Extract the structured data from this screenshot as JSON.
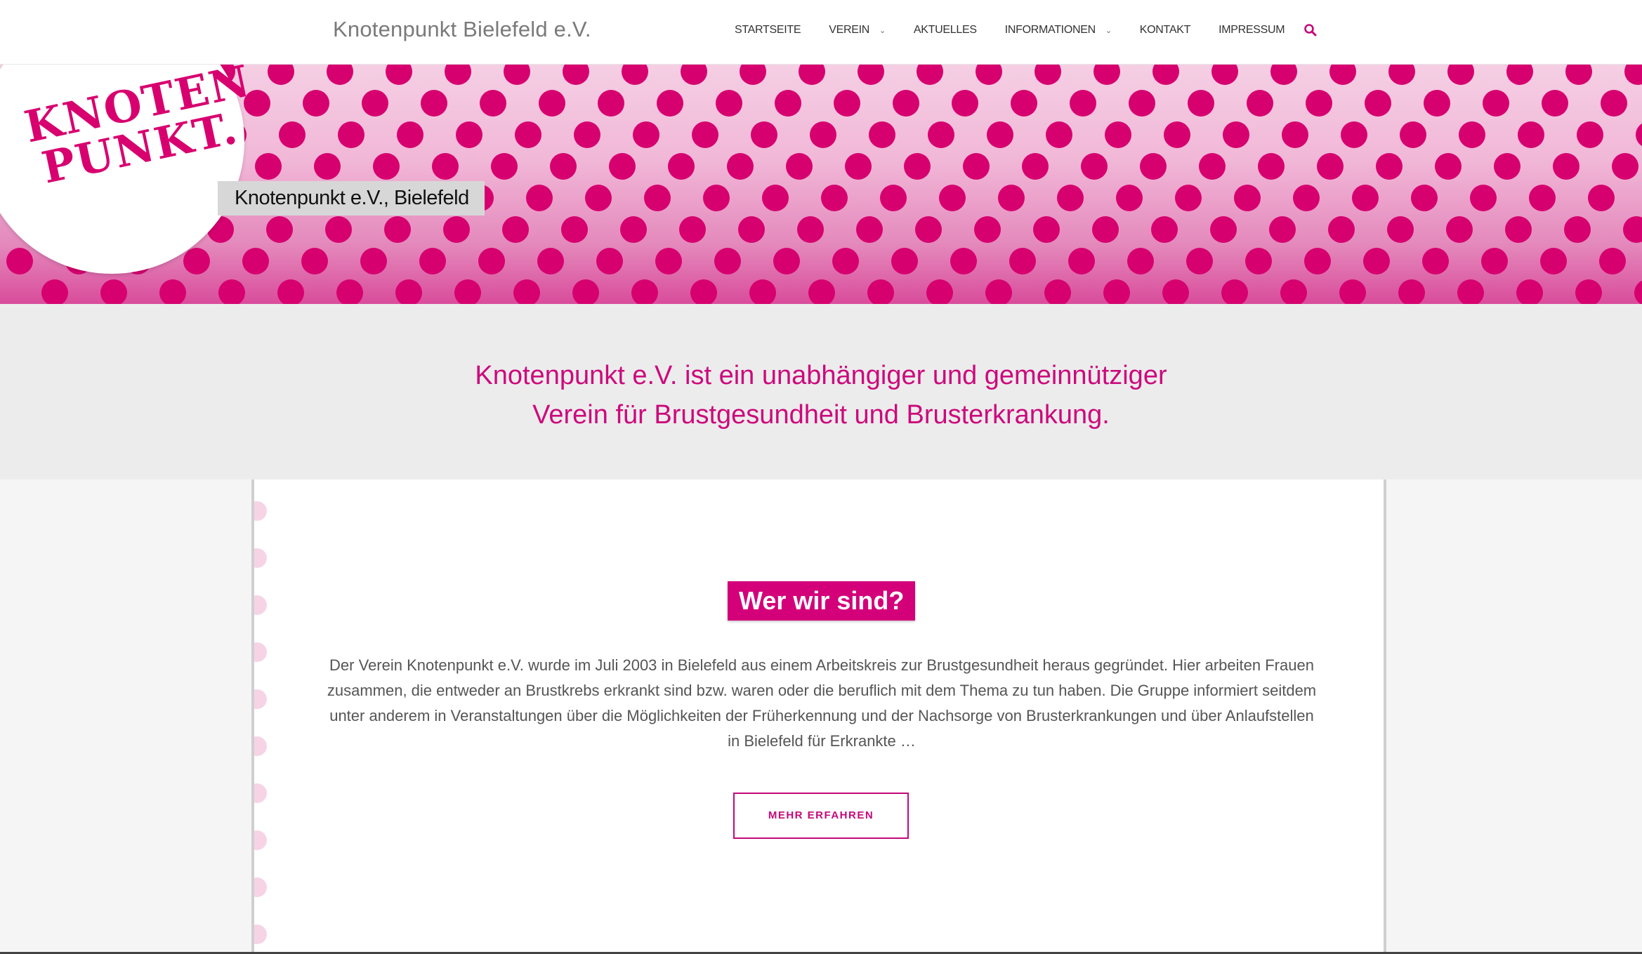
{
  "header": {
    "site_title": "Knotenpunkt Bielefeld e.V.",
    "nav": [
      {
        "label": "STARTSEITE",
        "has_dropdown": false
      },
      {
        "label": "VEREIN",
        "has_dropdown": true
      },
      {
        "label": "AKTUELLES",
        "has_dropdown": false
      },
      {
        "label": "INFORMATIONEN",
        "has_dropdown": true
      },
      {
        "label": "KONTAKT",
        "has_dropdown": false
      },
      {
        "label": "IMPRESSUM",
        "has_dropdown": false
      }
    ],
    "search_icon": "search-icon"
  },
  "banner": {
    "logo_line1": "KNOTEN",
    "logo_line2": "PUNKT.",
    "label": "Knotenpunkt e.V., Bielefeld"
  },
  "tagline": {
    "line1": "Knotenpunkt e.V. ist ein unabhängiger und gemeinnütziger",
    "line2": "Verein für Brustgesundheit und Brusterkrankung."
  },
  "about": {
    "heading": "Wer wir sind?",
    "text": "Der Verein Knotenpunkt e.V. wurde im Juli 2003 in Bielefeld aus einem Arbeitskreis zur Brustgesundheit heraus gegründet. Hier arbeiten Frauen zusammen, die entweder an Brustkrebs erkrankt sind bzw. waren oder die beruflich mit dem Thema zu tun haben.  Die Gruppe informiert seitdem unter anderem in Veranstaltungen über die Möglichkeiten der Früherkennung und der Nachsorge von Brusterkrankungen und über Anlaufstellen in Bielefeld für Erkrankte …",
    "button_label": "MEHR ERFAHREN"
  },
  "colors": {
    "accent": "#d3007a",
    "dot": "#d6006f",
    "tagline": "#cc0a7c"
  }
}
